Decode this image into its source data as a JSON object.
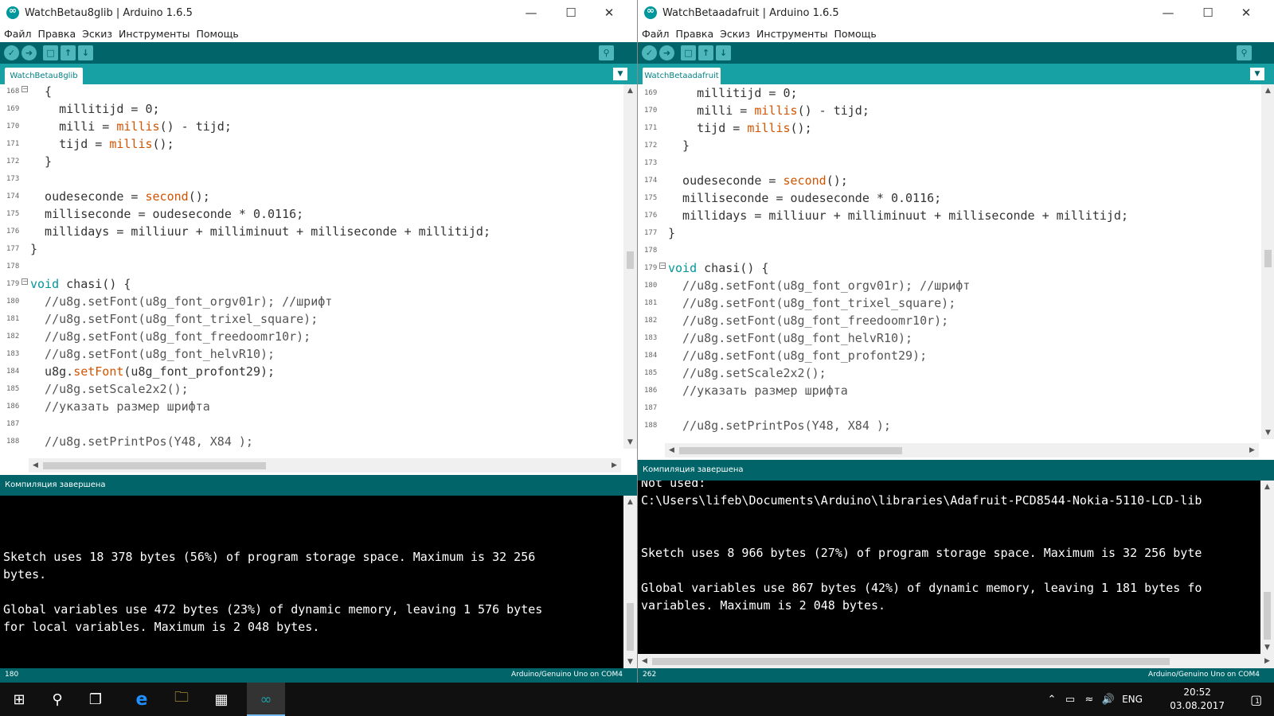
{
  "left": {
    "title": "WatchBetau8glib | Arduino 1.6.5",
    "menu": [
      "Файл",
      "Правка",
      "Эскиз",
      "Инструменты",
      "Помощь"
    ],
    "tab": "WatchBetau8glib",
    "status": "Компиляция завершена",
    "footer_line": "180",
    "footer_board": "Arduino/Genuino Uno on COM4",
    "lines": [
      {
        "n": "168",
        "t": "  {"
      },
      {
        "n": "169",
        "t": "    millitijd = 0;"
      },
      {
        "n": "170",
        "t": "    milli = millis() - tijd;"
      },
      {
        "n": "171",
        "t": "    tijd = millis();"
      },
      {
        "n": "172",
        "t": "  }"
      },
      {
        "n": "173",
        "t": ""
      },
      {
        "n": "174",
        "t": "  oudeseconde = second();"
      },
      {
        "n": "175",
        "t": "  milliseconde = oudeseconde * 0.0116;"
      },
      {
        "n": "176",
        "t": "  millidays = milliuur + milliminuut + milliseconde + millitijd;"
      },
      {
        "n": "177",
        "t": "}"
      },
      {
        "n": "178",
        "t": ""
      },
      {
        "n": "179",
        "t": "void chasi() {"
      },
      {
        "n": "180",
        "t": "  //u8g.setFont(u8g_font_orgv01r); //шрифт"
      },
      {
        "n": "181",
        "t": "  //u8g.setFont(u8g_font_trixel_square);"
      },
      {
        "n": "182",
        "t": "  //u8g.setFont(u8g_font_freedoomr10r);"
      },
      {
        "n": "183",
        "t": "  //u8g.setFont(u8g_font_helvR10);"
      },
      {
        "n": "184",
        "t": "  u8g.setFont(u8g_font_profont29);"
      },
      {
        "n": "185",
        "t": "  //u8g.setScale2x2();"
      },
      {
        "n": "186",
        "t": "  //указать размер шрифта"
      },
      {
        "n": "187",
        "t": ""
      },
      {
        "n": "188",
        "t": "  //u8g.setPrintPos(Y48, X84 );"
      }
    ],
    "console": [
      "",
      "",
      "",
      "Sketch uses 18 378 bytes (56%) of program storage space. Maximum is 32 256",
      "bytes.",
      "",
      "Global variables use 472 bytes (23%) of dynamic memory, leaving 1 576 bytes",
      "for local variables. Maximum is 2 048 bytes."
    ]
  },
  "right": {
    "title": "WatchBetaadafruit | Arduino 1.6.5",
    "menu": [
      "Файл",
      "Правка",
      "Эскиз",
      "Инструменты",
      "Помощь"
    ],
    "tab": "WatchBetaadafruit",
    "status": "Компиляция завершена",
    "footer_line": "262",
    "footer_board": "Arduino/Genuino Uno on COM4",
    "lines": [
      {
        "n": "169",
        "t": "    millitijd = 0;"
      },
      {
        "n": "170",
        "t": "    milli = millis() - tijd;"
      },
      {
        "n": "171",
        "t": "    tijd = millis();"
      },
      {
        "n": "172",
        "t": "  }"
      },
      {
        "n": "173",
        "t": ""
      },
      {
        "n": "174",
        "t": "  oudeseconde = second();"
      },
      {
        "n": "175",
        "t": "  milliseconde = oudeseconde * 0.0116;"
      },
      {
        "n": "176",
        "t": "  millidays = milliuur + milliminuut + milliseconde + millitijd;"
      },
      {
        "n": "177",
        "t": "}"
      },
      {
        "n": "178",
        "t": ""
      },
      {
        "n": "179",
        "t": "void chasi() {"
      },
      {
        "n": "180",
        "t": "  //u8g.setFont(u8g_font_orgv01r); //шрифт"
      },
      {
        "n": "181",
        "t": "  //u8g.setFont(u8g_font_trixel_square);"
      },
      {
        "n": "182",
        "t": "  //u8g.setFont(u8g_font_freedoomr10r);"
      },
      {
        "n": "183",
        "t": "  //u8g.setFont(u8g_font_helvR10);"
      },
      {
        "n": "184",
        "t": "  //u8g.setFont(u8g_font_profont29);"
      },
      {
        "n": "185",
        "t": "  //u8g.setScale2x2();"
      },
      {
        "n": "186",
        "t": "  //указать размер шрифта"
      },
      {
        "n": "187",
        "t": ""
      },
      {
        "n": "188",
        "t": "  //u8g.setPrintPos(Y48, X84 );"
      }
    ],
    "console": [
      "Not used:",
      "C:\\Users\\lifeb\\Documents\\Arduino\\libraries\\Adafruit-PCD8544-Nokia-5110-LCD-lib",
      "",
      "",
      "Sketch uses 8 966 bytes (27%) of program storage space. Maximum is 32 256 byte",
      "",
      "Global variables use 867 bytes (42%) of dynamic memory, leaving 1 181 bytes fo",
      "variables. Maximum is 2 048 bytes."
    ]
  },
  "taskbar": {
    "lang": "ENG",
    "time": "20:52",
    "date": "03.08.2017",
    "notification_count": "1",
    "apps": [
      "windows-start",
      "search",
      "task-view",
      "edge",
      "file-explorer",
      "store",
      "arduino"
    ]
  },
  "colors": {
    "arduino_dark": "#006468",
    "arduino_teal": "#17a1a5",
    "keyword": "#d35400",
    "type": "#00979c"
  }
}
